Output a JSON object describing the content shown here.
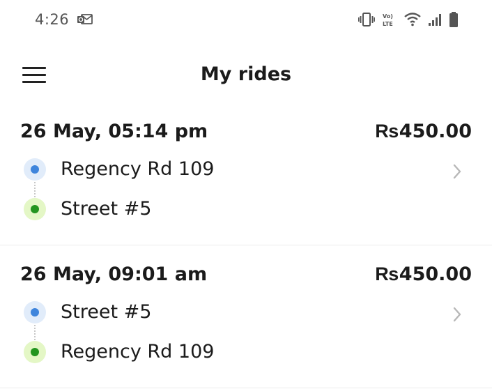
{
  "status_bar": {
    "time": "4:26",
    "icons": [
      "outlook-notification-icon",
      "vibrate-icon",
      "volte-icon",
      "wifi-icon",
      "signal-icon",
      "battery-icon"
    ],
    "volte_top": "Vo)",
    "volte_bottom": "LTE"
  },
  "app_bar": {
    "title": "My rides",
    "menu_icon": "menu-icon"
  },
  "rides": [
    {
      "datetime": "26 May, 05:14 pm",
      "currency": "Rs",
      "amount": "450.00",
      "pickup": "Regency Rd 109",
      "dropoff": "Street #5"
    },
    {
      "datetime": "26 May, 09:01 am",
      "currency": "Rs",
      "amount": "450.00",
      "pickup": "Street #5",
      "dropoff": "Regency Rd 109"
    }
  ],
  "colors": {
    "pickup_dot": "#3f85dc",
    "pickup_ring": "#e1ecfa",
    "dropoff_dot": "#23951f",
    "dropoff_ring": "#e4f7c6",
    "text": "#1b1b1b",
    "divider": "#ececec"
  }
}
